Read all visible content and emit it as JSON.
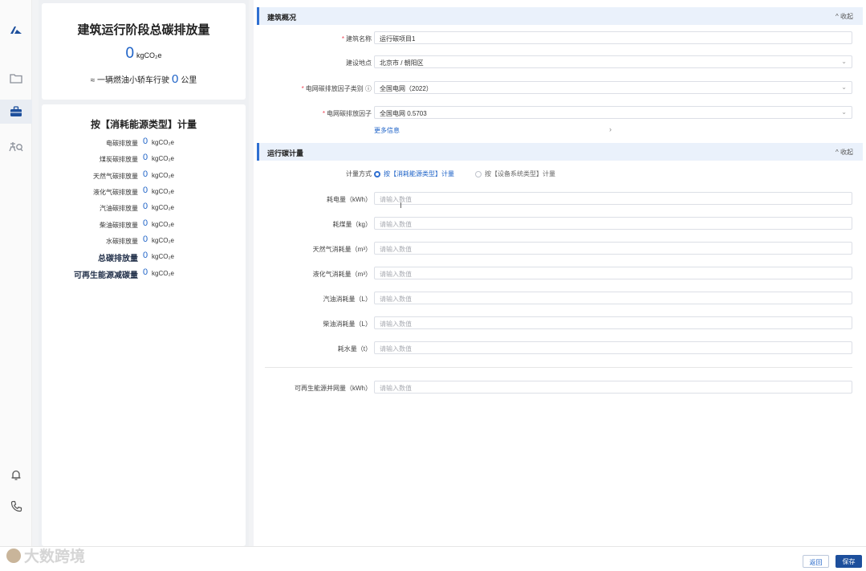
{
  "left_summary": {
    "title": "建筑运行阶段总碳排放量",
    "total_value": "0",
    "total_unit": "kgCO₂e",
    "equiv_prefix": "≈ 一辆燃油小轿车行驶",
    "equiv_value": "0",
    "equiv_unit": "公里"
  },
  "breakdown": {
    "title": "按【消耗能源类型】计量",
    "rows": [
      {
        "label": "电碳排放量",
        "value": "0",
        "unit": "kgCO₂e"
      },
      {
        "label": "煤炭碳排放量",
        "value": "0",
        "unit": "kgCO₂e"
      },
      {
        "label": "天然气碳排放量",
        "value": "0",
        "unit": "kgCO₂e"
      },
      {
        "label": "液化气碳排放量",
        "value": "0",
        "unit": "kgCO₂e"
      },
      {
        "label": "汽油碳排放量",
        "value": "0",
        "unit": "kgCO₂e"
      },
      {
        "label": "柴油碳排放量",
        "value": "0",
        "unit": "kgCO₂e"
      },
      {
        "label": "水碳排放量",
        "value": "0",
        "unit": "kgCO₂e"
      },
      {
        "label": "总碳排放量",
        "value": "0",
        "unit": "kgCO₂e"
      },
      {
        "label": "可再生能源减碳量",
        "value": "0",
        "unit": "kgCO₂e"
      }
    ]
  },
  "section_overview": {
    "title": "建筑概况",
    "collapse": "收起",
    "fields": [
      {
        "label": "建筑名称",
        "required": "*",
        "value": "运行碳项目1"
      },
      {
        "label": "建设地点",
        "required": "",
        "value": "北京市 / 朝阳区"
      },
      {
        "label": "电网碳排放因子类别 ⓘ",
        "required": "*",
        "value": "全国电网（2022）"
      },
      {
        "label": "电网碳排放因子",
        "required": "*",
        "value": "全国电网 0.5703"
      }
    ],
    "more_info": "更多信息",
    "more_arrow": "›"
  },
  "section_calc": {
    "title": "运行碳计量",
    "collapse": "收起",
    "method_label": "计量方式",
    "method_option_1": "按【消耗能源类型】计量",
    "method_option_2": "按【设备系统类型】计量",
    "placeholder": "请输入数值",
    "fields": [
      {
        "label": "耗电量（kWh）"
      },
      {
        "label": "耗煤量（kg）"
      },
      {
        "label": "天然气消耗量（m³）"
      },
      {
        "label": "液化气消耗量（m³）"
      },
      {
        "label": "汽油消耗量（L）"
      },
      {
        "label": "柴油消耗量（L）"
      },
      {
        "label": "耗水量（t）"
      }
    ],
    "renewable_label": "可再生能源并网量（kWh）"
  },
  "footer": {
    "back": "返回",
    "save": "保存",
    "watermark": "大数跨境"
  },
  "icons": {
    "chevron_up": "^",
    "chevron_down": "⌄"
  }
}
